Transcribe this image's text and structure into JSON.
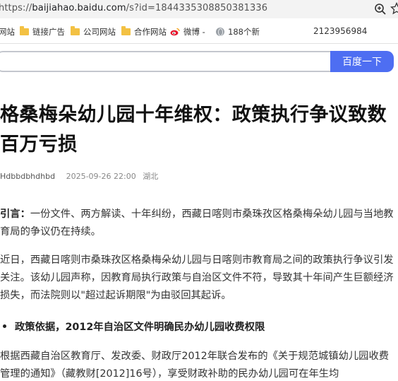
{
  "browser": {
    "url_prefix": "https://",
    "url_host": "baijiahao.baidu.com",
    "url_rest": "/s?id=1844335308850381336"
  },
  "bookmarks": [
    {
      "label": "网站",
      "icon": "none"
    },
    {
      "label": "链接广告",
      "icon": "folder-icon"
    },
    {
      "label": "公司网站",
      "icon": "folder-icon"
    },
    {
      "label": "合作网站",
      "icon": "folder-icon"
    },
    {
      "label": "微博 -",
      "icon": "weibo-icon"
    },
    {
      "label": "188个新",
      "icon": "globe-icon"
    }
  ],
  "bookmark_extra": "2123956984",
  "search": {
    "button_label": "百度一下"
  },
  "article": {
    "title": "格桑梅朵幼儿园十年维权：政策执行争议致数百万亏损",
    "author": "Hdbbdbhdhbd",
    "date": "2025-09-26 22:00",
    "location": "湖北",
    "p1_lead": "引言：",
    "p1_text": "一份文件、两方解读、十年纠纷，西藏日喀则市桑珠孜区格桑梅朵幼儿园与当地教育局的争议仍在持续。",
    "p2_text": "近日，西藏日喀则市桑珠孜区格桑梅朵幼儿园与日喀则市教育局之间的政策执行争议引发关注。该幼儿园声称，因教育局执行政策与自治区文件不符，导致其十年间产生巨额经济损失，而法院则以\"超过起诉期限\"为由驳回其起诉。",
    "bullet": "政策依据，2012年自治区文件明确民办幼儿园收费权限",
    "p3_text": "根据西藏自治区教育厅、发改委、财政厅2012年联合发布的《关于规范城镇幼儿园收费管理的通知》（藏教财[2012]16号），享受财政补助的民办幼儿园可在年生均"
  },
  "colors": {
    "accent": "#4e6ef2",
    "folder": "#f3c143"
  }
}
